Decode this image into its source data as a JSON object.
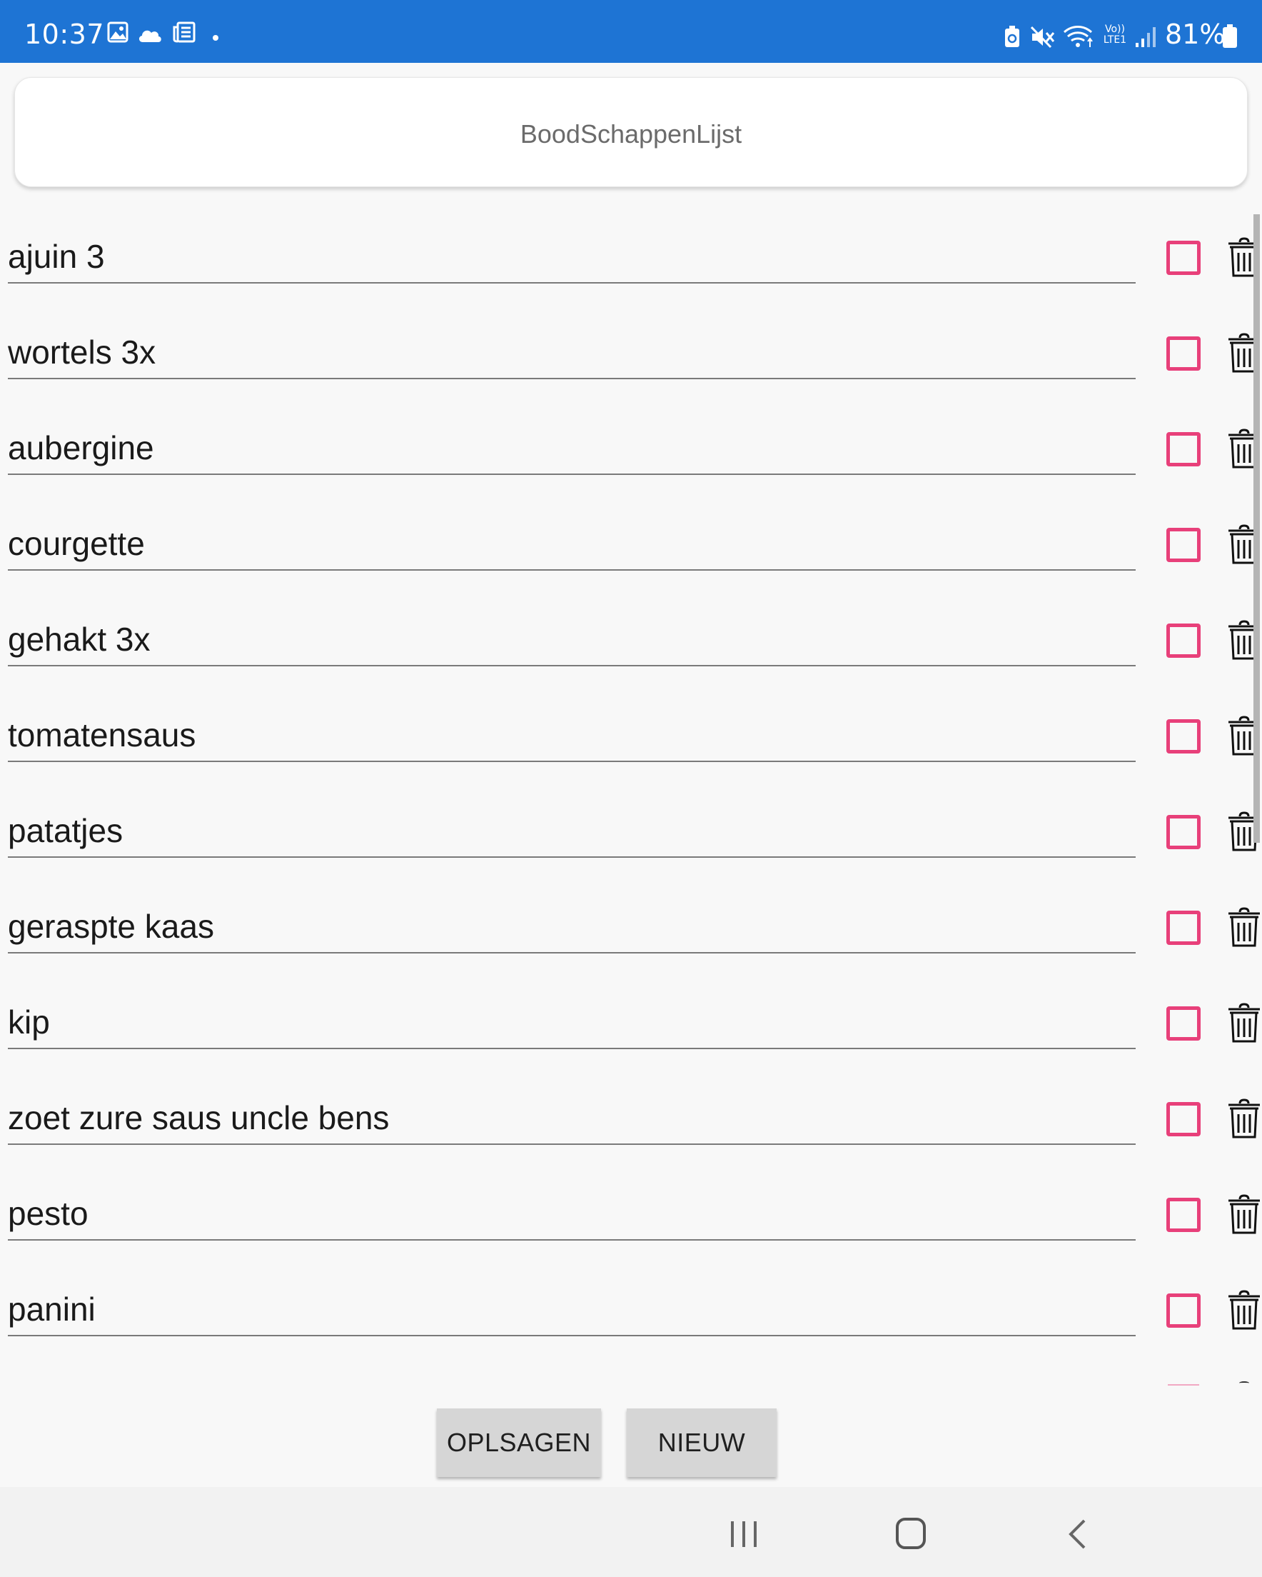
{
  "status_bar": {
    "time": "10:37",
    "battery": "81%",
    "left_icons": [
      "gallery-icon",
      "cloud-icon",
      "news-icon",
      "dot-icon"
    ],
    "right_icons": [
      "battery-saver-icon",
      "mute-icon",
      "wifi-icon",
      "volte-icon",
      "signal-icon",
      "battery-icon"
    ],
    "volte_label_top": "Vo))",
    "volte_label_bottom": "LTE1"
  },
  "header": {
    "title": "BoodSchappenLijst"
  },
  "items": [
    {
      "label": "ajuin 3",
      "checked": false
    },
    {
      "label": "wortels 3x",
      "checked": false
    },
    {
      "label": "aubergine",
      "checked": false
    },
    {
      "label": "courgette",
      "checked": false
    },
    {
      "label": "gehakt 3x",
      "checked": false
    },
    {
      "label": "tomatensaus",
      "checked": false
    },
    {
      "label": "patatjes",
      "checked": false
    },
    {
      "label": "geraspte kaas",
      "checked": false
    },
    {
      "label": "kip",
      "checked": false
    },
    {
      "label": "zoet zure saus uncle bens",
      "checked": false
    },
    {
      "label": "pesto",
      "checked": false
    },
    {
      "label": "panini",
      "checked": false
    }
  ],
  "buttons": {
    "save_label": "OPLSAGEN",
    "new_label": "NIEUW"
  },
  "nav": [
    "recents-icon",
    "home-icon",
    "back-icon"
  ],
  "colors": {
    "status_bar": "#1e74d4",
    "checkbox_accent": "#e8407a",
    "button_bg": "#d6d6d6",
    "background": "#f8f8f8"
  }
}
